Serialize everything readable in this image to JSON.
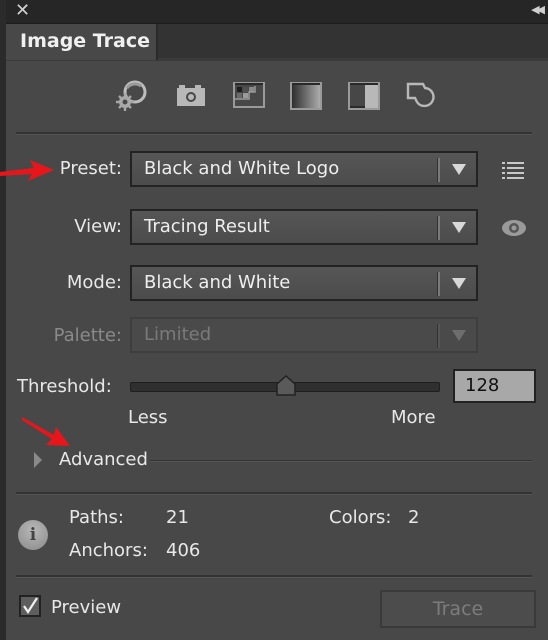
{
  "window": {
    "close_icon": "close-icon",
    "collapse_icon": "double-chevron-left-icon"
  },
  "tab": {
    "label": "Image Trace"
  },
  "preset_icons": [
    {
      "name": "auto-color",
      "icon": "auto-color-gear-icon"
    },
    {
      "name": "high-color",
      "icon": "camera-icon"
    },
    {
      "name": "low-color",
      "icon": "color-grid-icon"
    },
    {
      "name": "grayscale",
      "icon": "gradient-icon"
    },
    {
      "name": "black-and-white",
      "icon": "half-square-icon"
    },
    {
      "name": "outline",
      "icon": "outline-shape-icon"
    }
  ],
  "fields": {
    "preset": {
      "label": "Preset:",
      "value": "Black and White Logo",
      "side_icon": "list-menu-icon"
    },
    "view": {
      "label": "View:",
      "value": "Tracing Result",
      "side_icon": "eye-icon"
    },
    "mode": {
      "label": "Mode:",
      "value": "Black and White"
    },
    "palette": {
      "label": "Palette:",
      "value": "Limited",
      "disabled": true
    }
  },
  "threshold": {
    "label": "Threshold:",
    "value": "128",
    "min": 0,
    "max": 255,
    "fraction": 0.5,
    "less_label": "Less",
    "more_label": "More"
  },
  "advanced": {
    "label": "Advanced",
    "expanded": false
  },
  "stats": {
    "paths_label": "Paths:",
    "paths_value": "21",
    "colors_label": "Colors:",
    "colors_value": "2",
    "anchors_label": "Anchors:",
    "anchors_value": "406"
  },
  "footer": {
    "preview_label": "Preview",
    "preview_checked": true,
    "trace_label": "Trace",
    "trace_enabled": false
  },
  "annotations": {
    "arrow_color": "#e8151b"
  }
}
